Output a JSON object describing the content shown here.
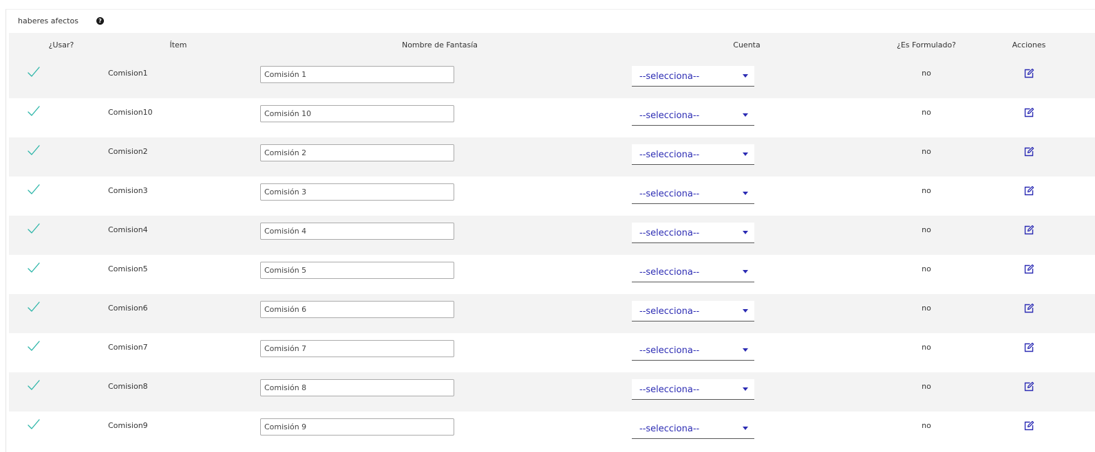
{
  "panel": {
    "title": "haberes afectos",
    "help_icon": "question-circle-icon"
  },
  "table": {
    "headers": {
      "usar": "¿Usar?",
      "item": "Ítem",
      "nombre": "Nombre de Fantasía",
      "cuenta": "Cuenta",
      "formulado": "¿Es Formulado?",
      "acciones": "Acciones"
    },
    "rows": [
      {
        "item": "Comision1",
        "nombre": "Comisión 1",
        "cuenta": "--selecciona--",
        "formulado": "no"
      },
      {
        "item": "Comision10",
        "nombre": "Comisión 10",
        "cuenta": "--selecciona--",
        "formulado": "no"
      },
      {
        "item": "Comision2",
        "nombre": "Comisión 2",
        "cuenta": "--selecciona--",
        "formulado": "no"
      },
      {
        "item": "Comision3",
        "nombre": "Comisión 3",
        "cuenta": "--selecciona--",
        "formulado": "no"
      },
      {
        "item": "Comision4",
        "nombre": "Comisión 4",
        "cuenta": "--selecciona--",
        "formulado": "no"
      },
      {
        "item": "Comision5",
        "nombre": "Comisión 5",
        "cuenta": "--selecciona--",
        "formulado": "no"
      },
      {
        "item": "Comision6",
        "nombre": "Comisión 6",
        "cuenta": "--selecciona--",
        "formulado": "no"
      },
      {
        "item": "Comision7",
        "nombre": "Comisión 7",
        "cuenta": "--selecciona--",
        "formulado": "no"
      },
      {
        "item": "Comision8",
        "nombre": "Comisión 8",
        "cuenta": "--selecciona--",
        "formulado": "no"
      },
      {
        "item": "Comision9",
        "nombre": "Comisión 9",
        "cuenta": "--selecciona--",
        "formulado": "no"
      }
    ]
  },
  "colors": {
    "check": "#2bb5a8",
    "link": "#2b2bb3",
    "stripe": "#f3f3f3"
  },
  "icons": {
    "usar": "checkmark-icon",
    "accion": "edit-icon",
    "select": "caret-down-icon"
  }
}
